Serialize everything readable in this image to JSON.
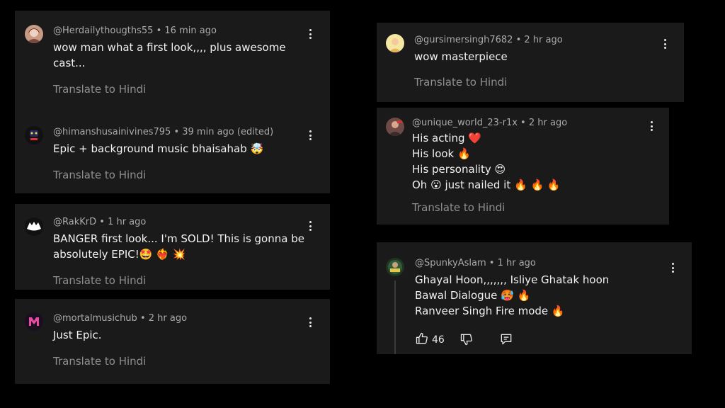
{
  "card_a": {
    "c1": {
      "username": "@Herdailythougths55",
      "time": "16 min ago",
      "lines": [
        "wow man what a first look,,,, plus awesome",
        "cast..."
      ],
      "translate": "Translate to Hindi"
    },
    "c2": {
      "username": "@himanshusainivines795",
      "time": "39 min ago (edited)",
      "lines": [
        "Epic + background music  bhaisahab 🤯"
      ],
      "translate": "Translate to Hindi"
    }
  },
  "card_b": {
    "username": "@RakKrD",
    "time": "1 hr ago",
    "lines": [
      "BANGER first look... I'm SOLD! This is gonna be",
      "absolutely EPIC!🤩 ❤️‍🔥 💥"
    ],
    "translate": "Translate to Hindi"
  },
  "card_c": {
    "username": "@mortalmusichub",
    "time": "2 hr ago",
    "lines": [
      "Just Epic."
    ],
    "translate": "Translate to Hindi"
  },
  "card_d": {
    "username": "@gursimersingh7682",
    "time": "2 hr ago",
    "lines": [
      "wow masterpiece"
    ],
    "translate": "Translate to Hindi"
  },
  "card_e": {
    "username": "@unique_world_23-r1x",
    "time": "2 hr ago",
    "lines": [
      "His acting ❤️",
      "His look 🔥",
      "His personality 😍",
      "Oh 😮 just nailed it 🔥 🔥 🔥"
    ],
    "translate": "Translate to Hindi"
  },
  "card_f": {
    "username": "@SpunkyAslam",
    "time": "1 hr ago",
    "lines": [
      "Ghayal Hoon,,,,,,, Isliye Ghatak hoon",
      "Bawal Dialogue 🥵 🔥",
      "Ranveer Singh Fire mode 🔥"
    ],
    "likes": "46"
  },
  "colors": {
    "background": "#000000",
    "card": "#1a1a1a",
    "text": "#f1f1f1",
    "meta": "#aaaaaa",
    "translate": "#8f8f8f"
  },
  "icons": [
    "more-vert-icon",
    "thumb-up-icon",
    "thumb-down-icon",
    "reply-icon"
  ]
}
